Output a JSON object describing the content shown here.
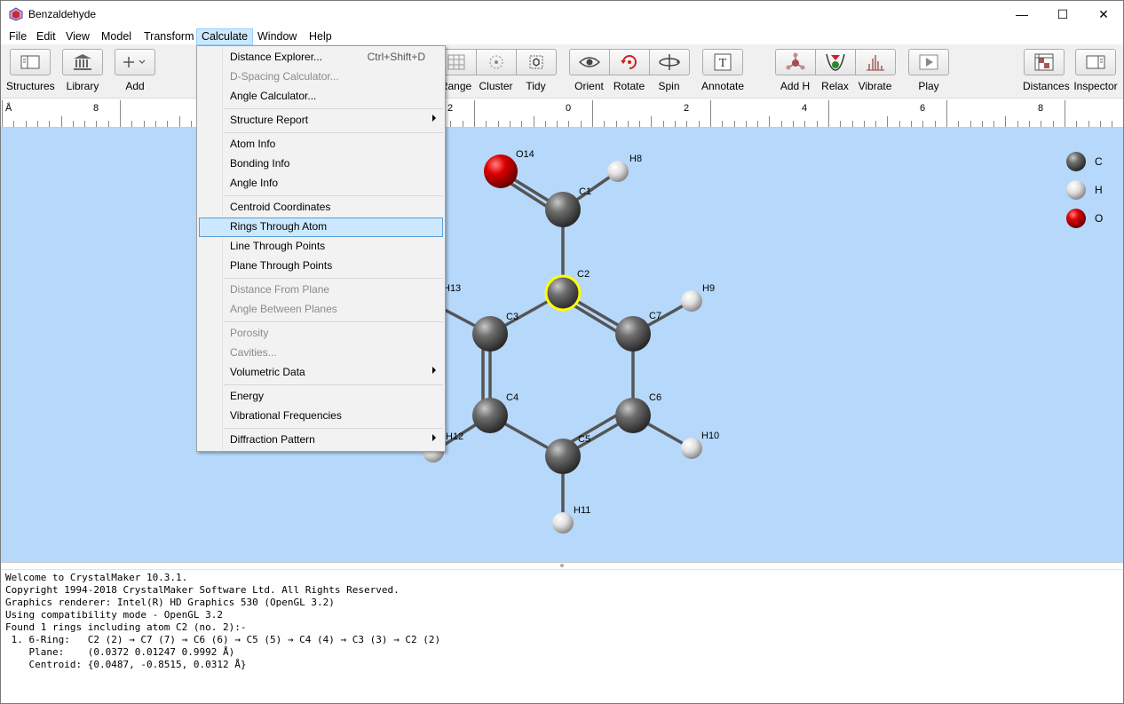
{
  "window": {
    "title": "Benzaldehyde",
    "minimize": "—",
    "maximize": "☐",
    "close": "✕"
  },
  "menu": [
    "File",
    "Edit",
    "View",
    "Model",
    "Transform",
    "Calculate",
    "Window",
    "Help"
  ],
  "toolbar": {
    "structures": "Structures",
    "library": "Library",
    "add": "Add",
    "range": "Range",
    "cluster": "Cluster",
    "tidy": "Tidy",
    "orient": "Orient",
    "rotate": "Rotate",
    "spin": "Spin",
    "annotate": "Annotate",
    "addh": "Add H",
    "relax": "Relax",
    "vibrate": "Vibrate",
    "play": "Play",
    "distances": "Distances",
    "inspector": "Inspector"
  },
  "ruler": {
    "unit": "Å",
    "labels": [
      "8",
      "2",
      "0",
      "2",
      "4",
      "6",
      "8"
    ]
  },
  "calculate_menu": {
    "distance_explorer": "Distance Explorer...",
    "distance_shortcut": "Ctrl+Shift+D",
    "dspacing": "D-Spacing Calculator...",
    "angle_calc": "Angle Calculator...",
    "structure_report": "Structure Report",
    "atom_info": "Atom Info",
    "bonding_info": "Bonding Info",
    "angle_info": "Angle Info",
    "centroid": "Centroid Coordinates",
    "rings": "Rings Through Atom",
    "line": "Line Through Points",
    "plane": "Plane Through Points",
    "dist_plane": "Distance From Plane",
    "angle_planes": "Angle Between Planes",
    "porosity": "Porosity",
    "cavities": "Cavities...",
    "volumetric": "Volumetric Data",
    "energy": "Energy",
    "vib_freq": "Vibrational Frequencies",
    "diffraction": "Diffraction Pattern"
  },
  "atoms": {
    "o14": "O14",
    "h8": "H8",
    "c1": "C1",
    "c2": "C2",
    "h13": "H13",
    "h9": "H9",
    "c3": "C3",
    "c7": "C7",
    "c4": "C4",
    "c6": "C6",
    "h12": "H12",
    "c5": "C5",
    "h10": "H10",
    "h11": "H11"
  },
  "legend": {
    "c": "C",
    "h": "H",
    "o": "O"
  },
  "colors": {
    "carbon": "#5a5a5a",
    "hydrogen": "#e8e8e8",
    "oxygen": "#cc0000",
    "selection": "#ffff00",
    "background": "#b6d8fa"
  },
  "console": [
    "Welcome to CrystalMaker 10.3.1.",
    "Copyright 1994-2018 CrystalMaker Software Ltd. All Rights Reserved.",
    "Graphics renderer: Intel(R) HD Graphics 530 (OpenGL 3.2)",
    "Using compatibility mode - OpenGL 3.2",
    "Found 1 rings including atom C2 (no. 2):-",
    " 1. 6-Ring:   C2 (2) → C7 (7) → C6 (6) → C5 (5) → C4 (4) → C3 (3) → C2 (2)",
    "    Plane:    (0.0372 0.01247 0.9992 Å)",
    "    Centroid: {0.0487, -0.8515, 0.0312 Å}"
  ]
}
